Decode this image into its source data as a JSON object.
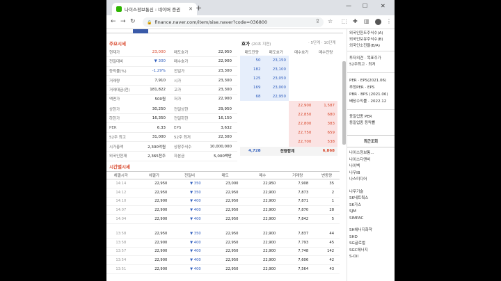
{
  "browser": {
    "tab_title": "나이스정보통신 : 네이버 증권",
    "url": "finance.naver.com/item/sise.naver?code=036800",
    "tab_close": "✕",
    "new_tab": "+"
  },
  "quote": {
    "title": "주요시세",
    "left": [
      {
        "k": "현재가",
        "v": "23,000",
        "k2": "매도호가",
        "v2": "22,950"
      },
      {
        "k": "전일대비",
        "v": "▼ 300",
        "k2": "매수호가",
        "v2": "22,900"
      },
      {
        "k": "등락률(%)",
        "v": "-1.29%",
        "k2": "전일가",
        "v2": "23,300"
      },
      {
        "k": "거래량",
        "v": "7,910",
        "k2": "시가",
        "v2": "23,300"
      },
      {
        "k": "거래대금(천)",
        "v": "181,822",
        "k2": "고가",
        "v2": "23,300"
      },
      {
        "k": "액면가",
        "v": "500원",
        "k2": "저가",
        "v2": "22,900"
      },
      {
        "k": "상한가",
        "v": "30,250",
        "k2": "전일상한",
        "v2": "29,950"
      },
      {
        "k": "하한가",
        "v": "16,350",
        "k2": "전일하한",
        "v2": "16,150"
      },
      {
        "k": "PER",
        "v": "6.33",
        "k2": "EPS",
        "v2": "3,632"
      },
      {
        "k": "52주 최고",
        "v": "31,000",
        "k2": "52주 최저",
        "v2": "22,300"
      },
      {
        "k": "시가총액",
        "v": "2,300억원",
        "k2": "상장주식수",
        "v2": "10,000,000"
      },
      {
        "k": "외국인현재",
        "v": "2,365천주",
        "k2": "자본금",
        "v2": "5,000백만"
      }
    ]
  },
  "orderbook": {
    "title": "호가",
    "sub": "(20초 지연)",
    "links": "· 5단계 · 10단계",
    "headers": [
      "매도잔량",
      "매도호가",
      "매수호가",
      "매수잔량"
    ],
    "sell": [
      {
        "qty": "50",
        "price": "23,150"
      },
      {
        "qty": "182",
        "price": "23,100"
      },
      {
        "qty": "125",
        "price": "23,050"
      },
      {
        "qty": "169",
        "price": "23,000"
      },
      {
        "qty": "68",
        "price": "22,950"
      }
    ],
    "buy": [
      {
        "price": "22,900",
        "qty": "1,587"
      },
      {
        "price": "22,850",
        "qty": "680"
      },
      {
        "price": "22,800",
        "qty": "383"
      },
      {
        "price": "22,750",
        "qty": "659"
      },
      {
        "price": "22,700",
        "qty": "538"
      }
    ],
    "total_sell": "4,728",
    "total_label": "잔량합계",
    "total_buy": "6,868"
  },
  "ticks": {
    "title": "시간별시세",
    "headers": [
      "체결시각",
      "체결가",
      "전일비",
      "매도",
      "매수",
      "거래량",
      "변동량"
    ],
    "rows": [
      [
        "14:14",
        "22,950",
        "▼ 350",
        "23,000",
        "22,950",
        "7,908",
        "35"
      ],
      [
        "14:12",
        "22,950",
        "▼ 350",
        "22,950",
        "22,900",
        "7,873",
        "2"
      ],
      [
        "14:10",
        "22,900",
        "▼ 400",
        "22,950",
        "22,900",
        "7,871",
        "1"
      ],
      [
        "14:07",
        "22,900",
        "▼ 400",
        "22,950",
        "22,900",
        "7,870",
        "28"
      ],
      [
        "14:04",
        "22,900",
        "▼ 400",
        "22,950",
        "22,900",
        "7,842",
        "5"
      ],
      [
        "13:58",
        "22,950",
        "▼ 350",
        "22,950",
        "22,900",
        "7,837",
        "44"
      ],
      [
        "13:58",
        "22,900",
        "▼ 400",
        "22,950",
        "22,900",
        "7,793",
        "45"
      ],
      [
        "13:57",
        "22,900",
        "▼ 400",
        "22,950",
        "22,900",
        "7,748",
        "142"
      ],
      [
        "13:54",
        "22,900",
        "▼ 400",
        "22,950",
        "22,900",
        "7,606",
        "42"
      ],
      [
        "13:51",
        "22,900",
        "▼ 400",
        "22,950",
        "22,900",
        "7,564",
        "43"
      ]
    ]
  },
  "right_panel": {
    "top": [
      "외국인한도주식수(A)",
      "외국인보유주식수(B)",
      "외국인소진율(B/A)"
    ],
    "mid1": [
      "투자의견 · 목표주가",
      "52주최고 · 최저"
    ],
    "mid2": [
      "PER · EPS(2021.06)",
      "추정PER · EPS",
      "PBR · BPS (2021.06)",
      "배당수익률 · 2022.12"
    ],
    "mid3": [
      "동일업종 PER",
      "동일업종 등락률"
    ],
    "recent_label": "최근조회",
    "recent": [
      "나이스정보통...",
      "나이스디앤비",
      "나이벡",
      "나우IB",
      "나스미디어"
    ],
    "list2": [
      "나무기술",
      "SK네트웍스",
      "SK가스",
      "SJM",
      "SIMPAC"
    ],
    "list3": [
      "SH에너지화학",
      "SHD",
      "SG글로벌",
      "SGC에너지",
      "S-Oil"
    ]
  }
}
